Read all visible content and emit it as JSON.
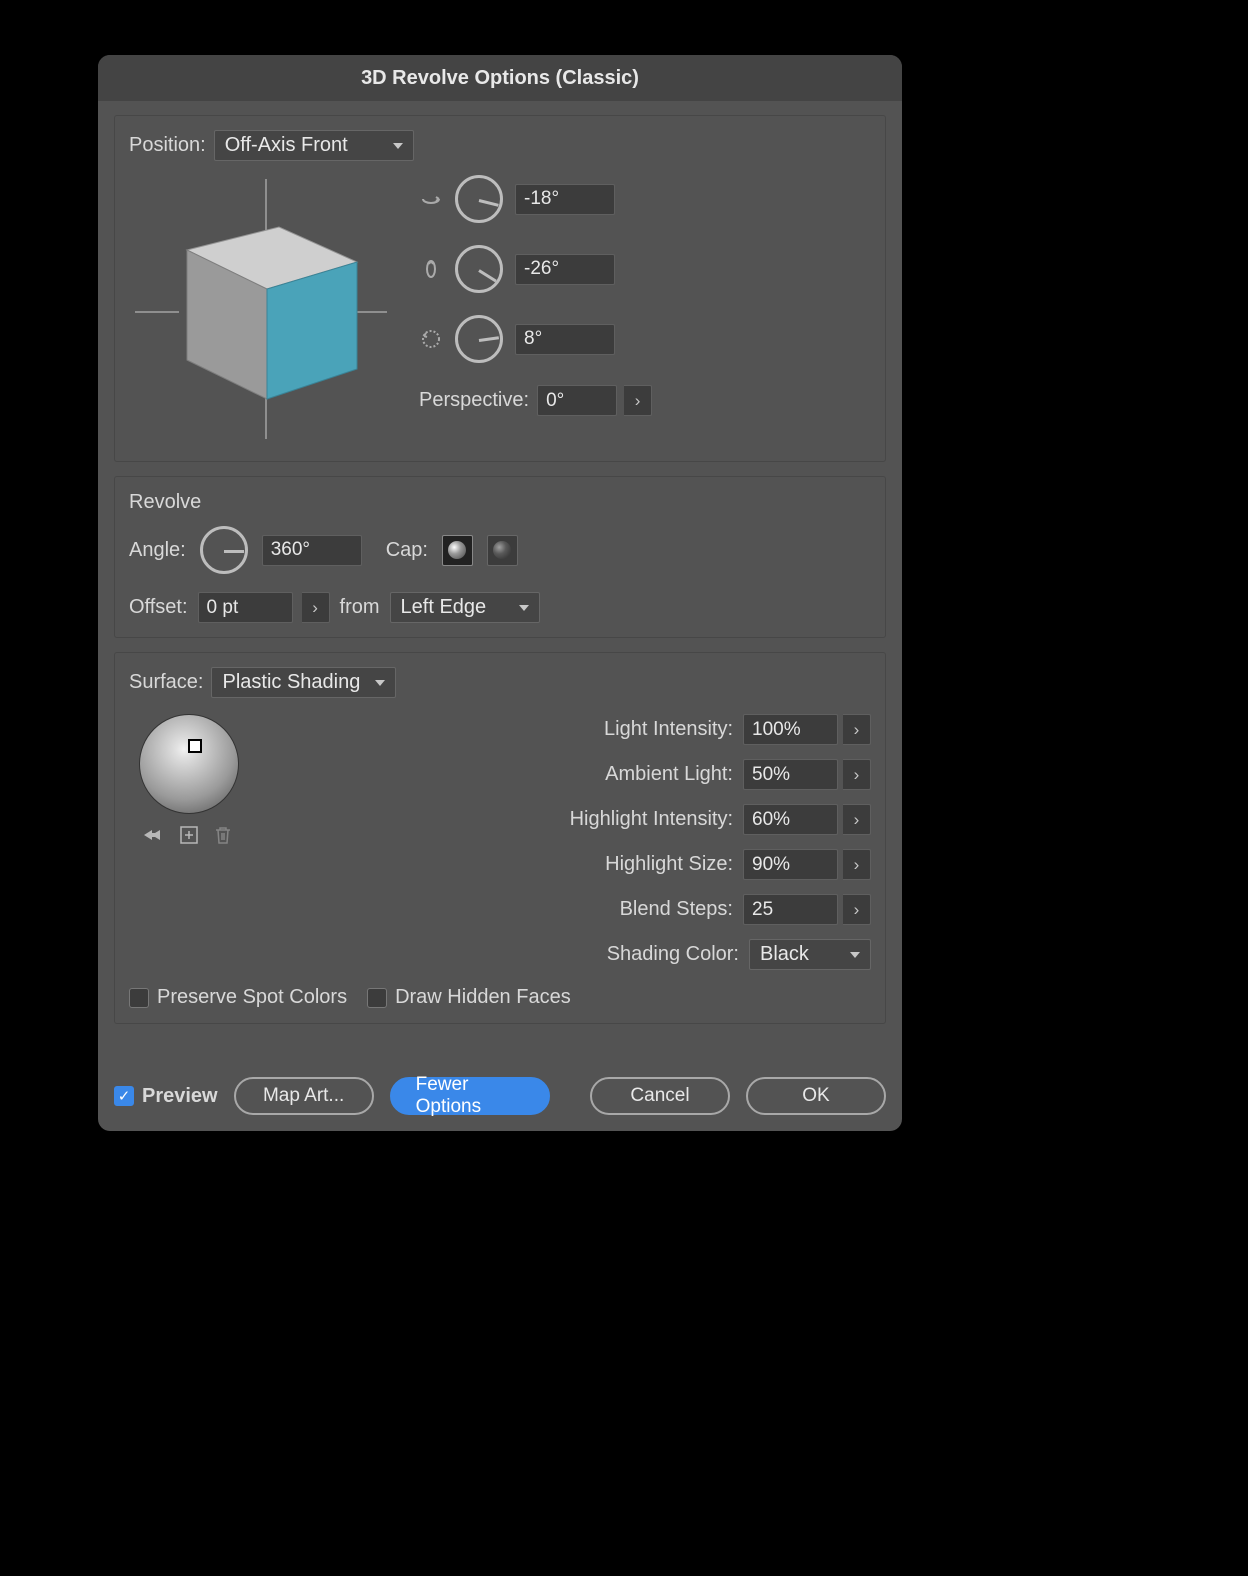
{
  "title": "3D Revolve Options (Classic)",
  "position": {
    "label": "Position:",
    "value": "Off-Axis Front",
    "rot_x": "-18°",
    "rot_y": "-26°",
    "rot_z": "8°",
    "perspective_label": "Perspective:",
    "perspective": "0°"
  },
  "revolve": {
    "title": "Revolve",
    "angle_label": "Angle:",
    "angle": "360°",
    "cap_label": "Cap:",
    "offset_label": "Offset:",
    "offset": "0 pt",
    "from_label": "from",
    "from_value": "Left Edge"
  },
  "surface": {
    "label": "Surface:",
    "value": "Plastic Shading",
    "light_intensity_label": "Light Intensity:",
    "light_intensity": "100%",
    "ambient_label": "Ambient Light:",
    "ambient": "50%",
    "highlight_intensity_label": "Highlight Intensity:",
    "highlight_intensity": "60%",
    "highlight_size_label": "Highlight Size:",
    "highlight_size": "90%",
    "blend_steps_label": "Blend Steps:",
    "blend_steps": "25",
    "shading_color_label": "Shading Color:",
    "shading_color": "Black",
    "preserve_spot": "Preserve Spot Colors",
    "draw_hidden": "Draw Hidden Faces"
  },
  "footer": {
    "preview": "Preview",
    "map_art": "Map Art...",
    "fewer": "Fewer Options",
    "cancel": "Cancel",
    "ok": "OK"
  }
}
